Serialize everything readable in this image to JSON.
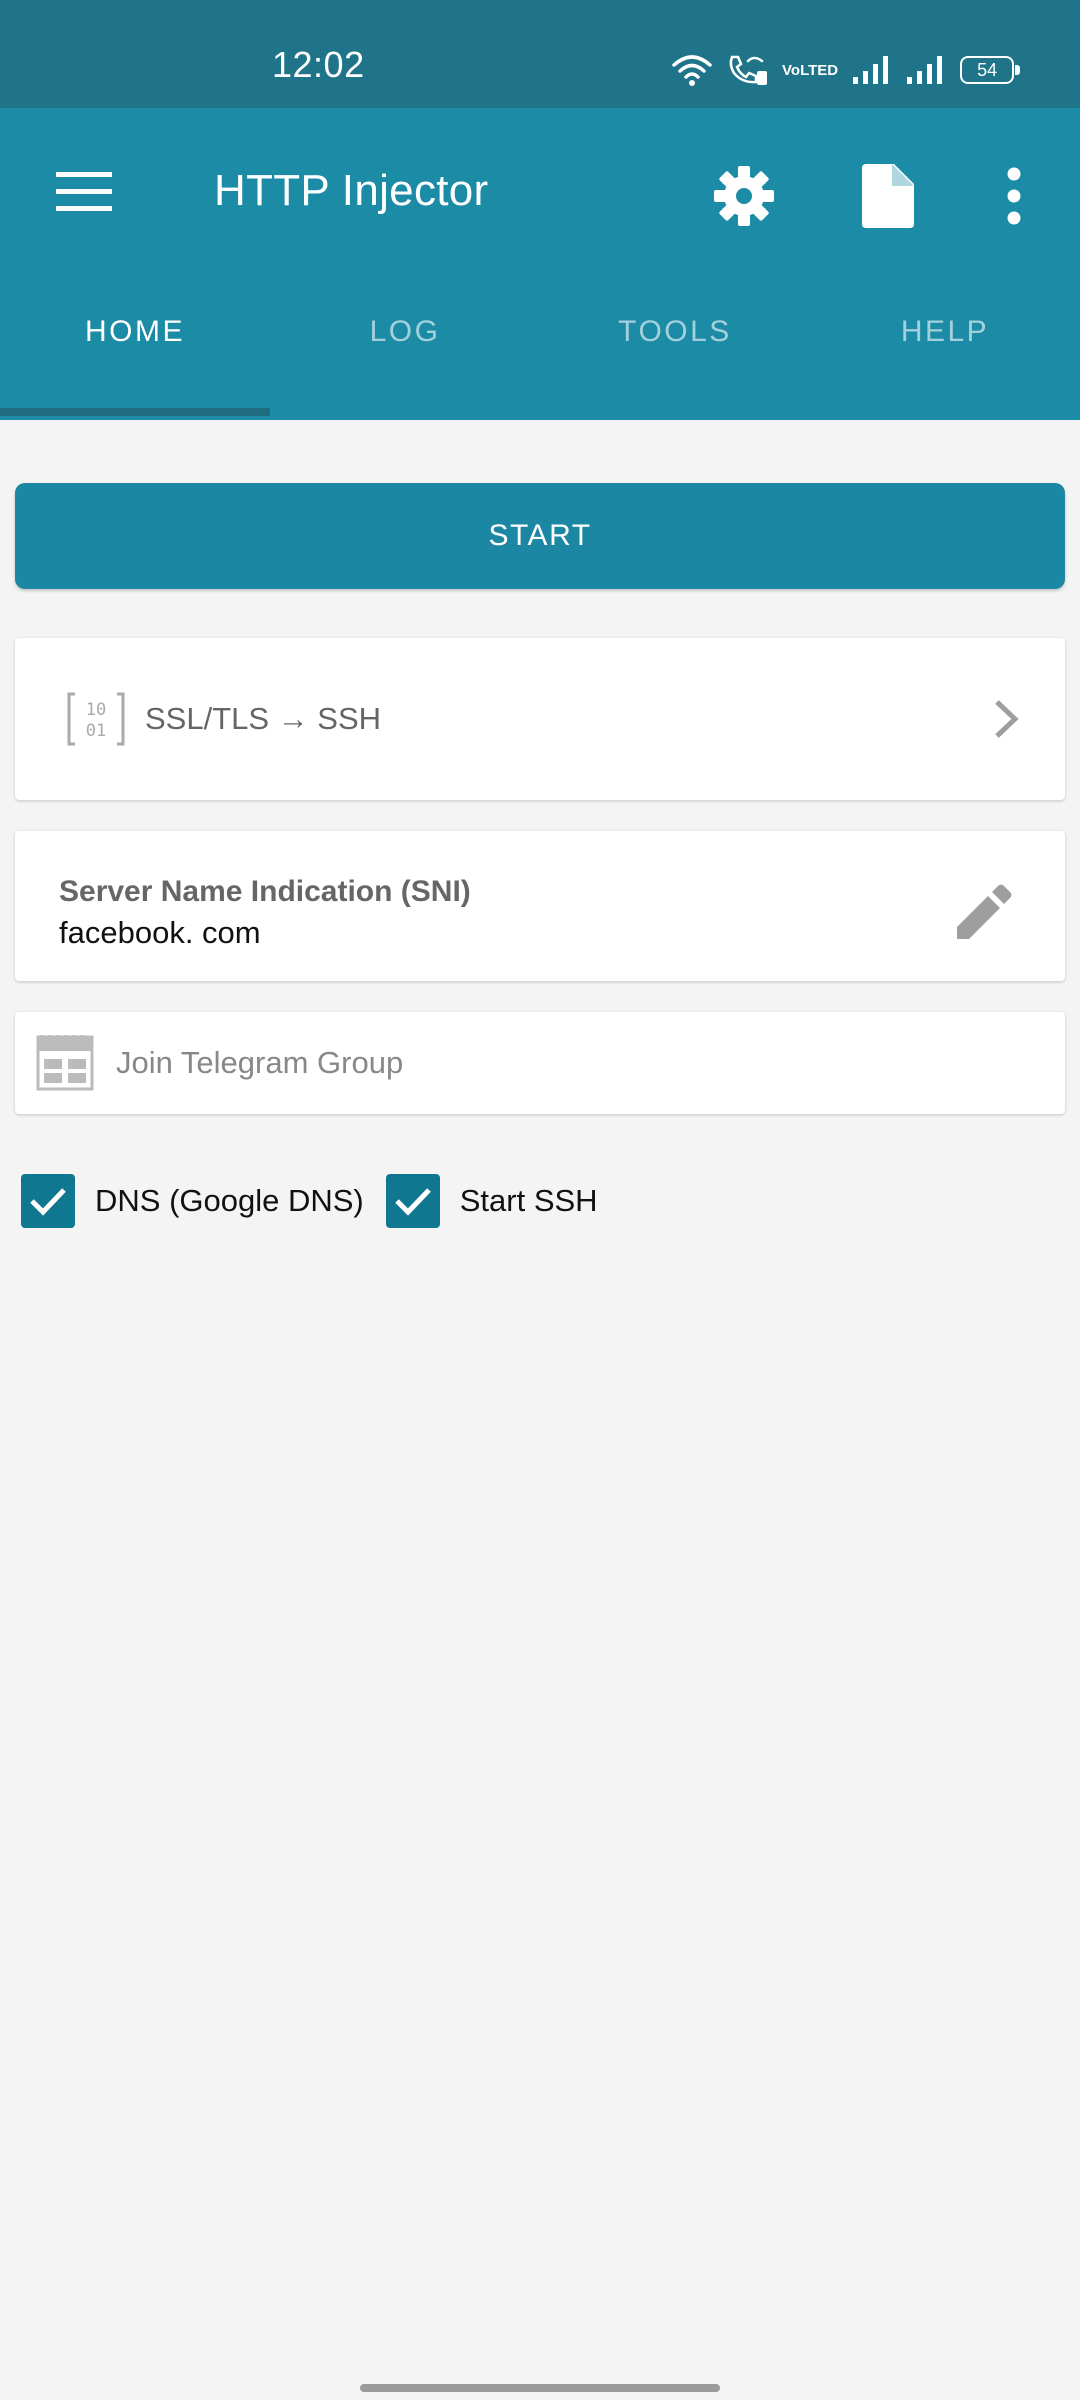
{
  "status_bar": {
    "time": "12:02",
    "volte_top": "Vo",
    "volte_bottom": "LTED",
    "battery": "54",
    "icons": [
      "wifi-icon",
      "wifi-calling-icon",
      "volte-icon",
      "signal-icon",
      "signal-icon",
      "battery-icon"
    ]
  },
  "app_bar": {
    "title": "HTTP Injector",
    "icons": [
      "menu-icon",
      "gear-icon",
      "file-icon",
      "more-vert-icon"
    ]
  },
  "tabs": [
    {
      "label": "HOME",
      "active": true
    },
    {
      "label": "LOG",
      "active": false
    },
    {
      "label": "TOOLS",
      "active": false
    },
    {
      "label": "HELP",
      "active": false
    }
  ],
  "start_button": {
    "label": "START"
  },
  "mode_card": {
    "label": "SSL/TLS → SSH",
    "icon": "binary-icon"
  },
  "sni_card": {
    "title": "Server Name Indication (SNI)",
    "value": "facebook. com",
    "icon": "edit-icon"
  },
  "telegram_card": {
    "label": "Join Telegram Group",
    "icon": "calendar-icon"
  },
  "checkboxes": [
    {
      "label": "DNS (Google DNS)",
      "checked": true
    },
    {
      "label": "Start SSH",
      "checked": true
    }
  ],
  "colors": {
    "status_bar": "#1f7489",
    "app_bar": "#1b8ba6",
    "primary_button": "#1b87a2",
    "checkbox": "#0f7890",
    "background": "#f4f4f4"
  }
}
